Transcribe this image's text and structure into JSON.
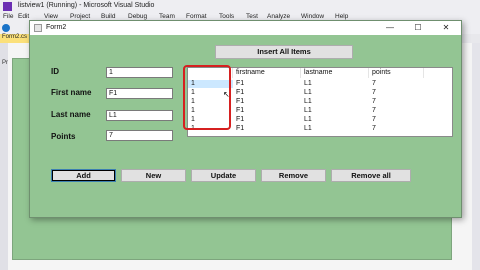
{
  "vs": {
    "title": "listview1 (Running) - Microsoft Visual Studio",
    "menu": [
      "File",
      "Edit",
      "View",
      "Project",
      "Build",
      "Debug",
      "Team",
      "Format",
      "Tools",
      "Test",
      "Analyze",
      "Window",
      "Help"
    ],
    "doc_tab": "Form2.cs",
    "process_label": "Proces"
  },
  "form": {
    "title": "Form2",
    "controls": {
      "minimize": "—",
      "maximize": "☐",
      "close": "✕"
    },
    "labels": {
      "id": "ID",
      "first_name": "First name",
      "last_name": "Last name",
      "points": "Points"
    },
    "fields": {
      "id": "1",
      "first_name": "F1",
      "last_name": "L1",
      "points": "7"
    },
    "buttons": {
      "insert_all": "Insert All Items",
      "add": "Add",
      "new": "New",
      "update": "Update",
      "remove": "Remove",
      "remove_all": "Remove all"
    },
    "listview": {
      "columns": [
        "",
        "firstname",
        "lastname",
        "points"
      ],
      "rows": [
        [
          "1",
          "F1",
          "L1",
          "7"
        ],
        [
          "1",
          "F1",
          "L1",
          "7"
        ],
        [
          "1",
          "F1",
          "L1",
          "7"
        ],
        [
          "1",
          "F1",
          "L1",
          "7"
        ],
        [
          "1",
          "F1",
          "L1",
          "7"
        ],
        [
          "1",
          "F1",
          "L1",
          "7"
        ]
      ]
    }
  }
}
